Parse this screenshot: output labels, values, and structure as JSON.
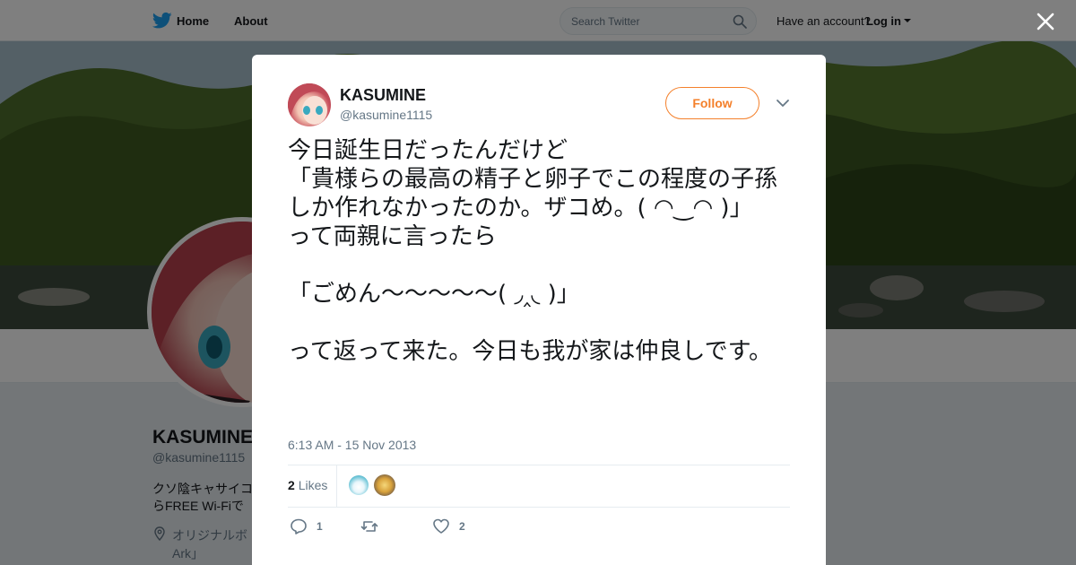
{
  "header": {
    "nav": {
      "home_label": "Home",
      "about_label": "About"
    },
    "search": {
      "placeholder": "Search Twitter"
    },
    "account": {
      "prompt": "Have an account?",
      "login_label": "Log in"
    }
  },
  "profile": {
    "name": "KASUMINE",
    "handle": "@kasumine1115",
    "bio_line1": "クソ陰キャサイコ",
    "bio_line2": "らFREE Wi-Fiで",
    "location_line1": "オリジナルボ",
    "location_line2": "Ark」"
  },
  "tweet": {
    "author_name": "KASUMINE",
    "author_handle": "@kasumine1115",
    "follow_label": "Follow",
    "text": "今日誕生日だったんだけど\n「貴様らの最高の精子と卵子でこの程度の子孫しか作れなかったのか。ザコめ。( ◠‿◠ )」\nって両親に言ったら\n\n「ごめん～～～～～( ◞‸◟ )」\n\nって返って来た。今日も我が家は仲良しです。",
    "timestamp": "6:13 AM - 15 Nov 2013",
    "likes_count": "2",
    "likes_label": "Likes",
    "reply_count": "1",
    "retweet_count": "",
    "like_count": "2"
  },
  "colors": {
    "accent": "#f4802b",
    "text_primary": "#14171a",
    "text_secondary": "#657786",
    "twitter_blue": "#1da1f2"
  },
  "icons": {
    "logo": "twitter-bird-icon",
    "search": "search-icon",
    "close": "close-icon",
    "reply": "reply-icon",
    "retweet": "retweet-icon",
    "like": "heart-icon",
    "location": "location-pin-icon",
    "more": "chevron-down-icon"
  }
}
